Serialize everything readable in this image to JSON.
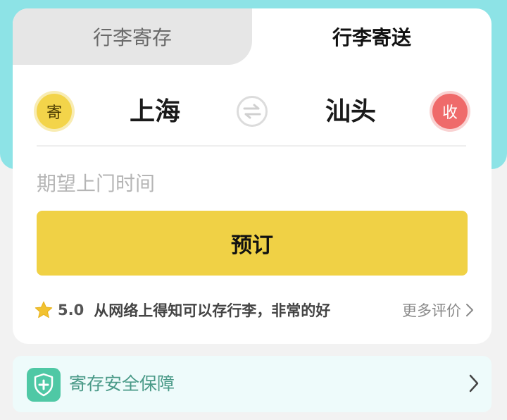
{
  "tabs": [
    {
      "label": "行李寄存",
      "active": false
    },
    {
      "label": "行李寄送",
      "active": true
    }
  ],
  "route": {
    "send_badge": "寄",
    "from_city": "上海",
    "to_city": "汕头",
    "receive_badge": "收",
    "swap_icon": "swap-icon"
  },
  "time_field": {
    "placeholder": "期望上门时间"
  },
  "book_button": {
    "label": "预订"
  },
  "review": {
    "rating": "5.0",
    "text": "从网络上得知可以存行李，非常的好",
    "more_label": "更多评价"
  },
  "safety": {
    "label": "寄存安全保障"
  },
  "colors": {
    "accent_yellow": "#f0d145",
    "header_teal": "#8de3e6",
    "receive_red": "#ef6a6a",
    "safety_green": "#4fc8a5"
  }
}
